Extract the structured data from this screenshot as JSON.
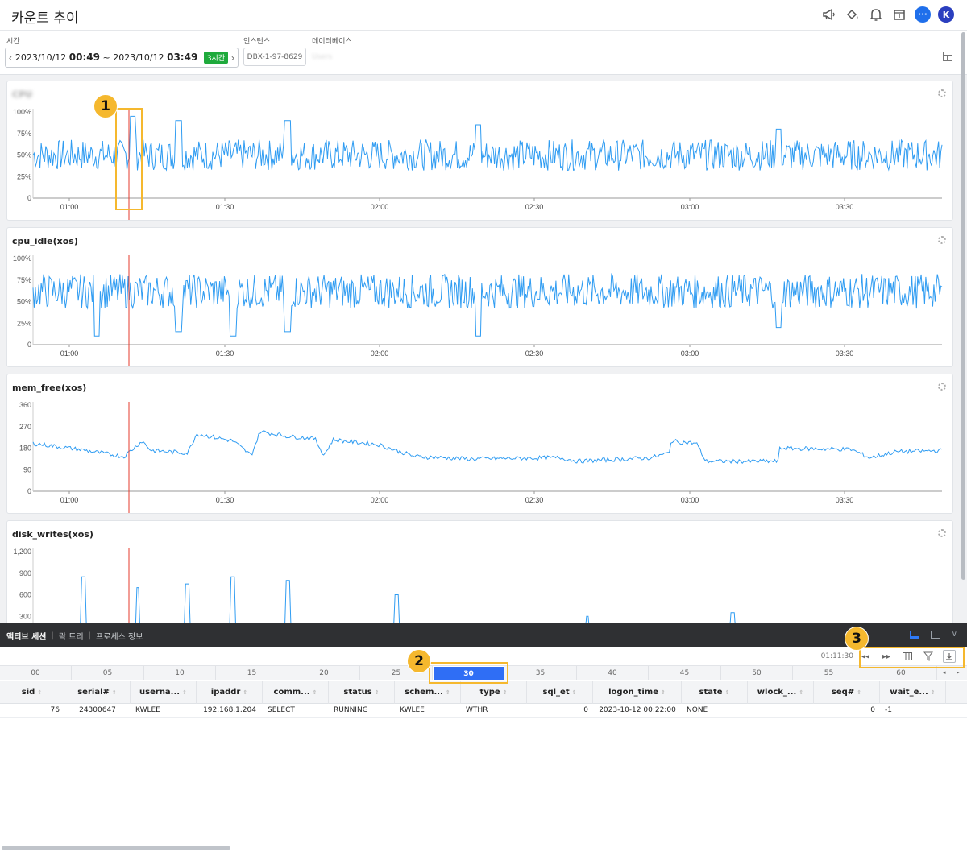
{
  "header": {
    "title": "카운트 추이",
    "icons": [
      "megaphone-icon",
      "paint-bucket-icon",
      "bell-icon",
      "calendar-icon",
      "chat-icon"
    ],
    "avatar_letter": "K",
    "chat_glyph": "···"
  },
  "filters": {
    "time_label": "시간",
    "time_start_date": "2023/10/12",
    "time_start_hm": "00:49",
    "time_sep": "~",
    "time_end_date": "2023/10/12",
    "time_end_hm": "03:49",
    "time_range_badge": "3시간",
    "prev_arrow": "‹",
    "next_arrow": "›",
    "instance_label": "인스턴스",
    "instance_value": "DBX-1-97-8629",
    "database_label": "데이터베이스",
    "database_value": "Users"
  },
  "charts": [
    {
      "title": "CPU",
      "title_blurred": true,
      "y_ticks": [
        "100%",
        "75%",
        "50%",
        "25%",
        "0"
      ],
      "x_ticks": [
        "01:00",
        "01:30",
        "02:00",
        "02:30",
        "03:00",
        "03:30"
      ],
      "chart_data": {
        "type": "line",
        "ylim": [
          0,
          100
        ],
        "x_range": [
          "00:49",
          "03:49"
        ],
        "cursor_time": "01:12",
        "baseline": 50,
        "amplitude": 18,
        "spikes": [
          [
            0.11,
            95
          ],
          [
            0.16,
            90
          ],
          [
            0.28,
            90
          ],
          [
            0.49,
            85
          ],
          [
            0.82,
            80
          ]
        ]
      }
    },
    {
      "title": "cpu_idle(xos)",
      "title_blurred": false,
      "y_ticks": [
        "100%",
        "75%",
        "50%",
        "25%",
        "0"
      ],
      "x_ticks": [
        "01:00",
        "01:30",
        "02:00",
        "02:30",
        "03:00",
        "03:30"
      ],
      "chart_data": {
        "type": "line",
        "ylim": [
          0,
          100
        ],
        "x_range": [
          "00:49",
          "03:49"
        ],
        "cursor_time": "01:12",
        "baseline": 62,
        "amplitude": 20,
        "dips": [
          [
            0.07,
            10
          ],
          [
            0.16,
            15
          ],
          [
            0.22,
            10
          ],
          [
            0.28,
            15
          ],
          [
            0.49,
            10
          ],
          [
            0.82,
            20
          ]
        ]
      }
    },
    {
      "title": "mem_free(xos)",
      "title_blurred": false,
      "y_ticks": [
        "360",
        "270",
        "180",
        "90",
        "0"
      ],
      "x_ticks": [
        "01:00",
        "01:30",
        "02:00",
        "02:30",
        "03:00",
        "03:30"
      ],
      "chart_data": {
        "type": "line",
        "ylim": [
          0,
          360
        ],
        "x_range": [
          "00:49",
          "03:49"
        ],
        "cursor_time": "01:12",
        "points": [
          [
            0.0,
            200
          ],
          [
            0.05,
            175
          ],
          [
            0.1,
            145
          ],
          [
            0.12,
            210
          ],
          [
            0.13,
            170
          ],
          [
            0.17,
            160
          ],
          [
            0.18,
            240
          ],
          [
            0.22,
            210
          ],
          [
            0.24,
            150
          ],
          [
            0.25,
            250
          ],
          [
            0.28,
            230
          ],
          [
            0.31,
            220
          ],
          [
            0.32,
            150
          ],
          [
            0.33,
            215
          ],
          [
            0.38,
            195
          ],
          [
            0.42,
            145
          ],
          [
            0.48,
            135
          ],
          [
            0.58,
            140
          ],
          [
            0.6,
            125
          ],
          [
            0.68,
            140
          ],
          [
            0.7,
            160
          ],
          [
            0.7,
            210
          ],
          [
            0.73,
            200
          ],
          [
            0.74,
            125
          ],
          [
            0.82,
            125
          ],
          [
            0.82,
            180
          ],
          [
            0.9,
            175
          ],
          [
            0.92,
            140
          ],
          [
            0.95,
            165
          ],
          [
            1.0,
            170
          ]
        ]
      }
    },
    {
      "title": "disk_writes(xos)",
      "title_blurred": false,
      "y_ticks": [
        "1,200",
        "900",
        "600",
        "300"
      ],
      "x_ticks": [],
      "chart_data": {
        "type": "line",
        "ylim": [
          0,
          1200
        ],
        "x_range": [
          "00:49",
          "03:49"
        ],
        "cursor_time": "01:12",
        "spikes": [
          [
            0.055,
            850
          ],
          [
            0.115,
            700
          ],
          [
            0.17,
            750
          ],
          [
            0.22,
            850
          ],
          [
            0.28,
            800
          ],
          [
            0.4,
            600
          ],
          [
            0.61,
            300
          ],
          [
            0.77,
            350
          ]
        ]
      }
    }
  ],
  "bottom_tabs": [
    "액티브 세션",
    "락 트리",
    "프로세스 정보"
  ],
  "session": {
    "time_display": "01:11:30",
    "toolbar_icons": [
      "rewind-icon",
      "fast-forward-icon",
      "columns-icon",
      "filter-icon",
      "download-icon"
    ],
    "timeline": [
      "00",
      "05",
      "10",
      "15",
      "20",
      "25",
      "30",
      "35",
      "40",
      "45",
      "50",
      "55",
      "60"
    ],
    "timeline_selected": "30",
    "columns": [
      "sid",
      "serial#",
      "userna...",
      "ipaddr",
      "comm...",
      "status",
      "schem...",
      "type",
      "sql_et",
      "logon_time",
      "state",
      "wlock_...",
      "seq#",
      "wait_e..."
    ],
    "rows": [
      [
        "76",
        "24300647",
        "KWLEE",
        "192.168.1.204",
        "SELECT",
        "RUNNING",
        "KWLEE",
        "WTHR",
        "0",
        "2023-10-12 00:22:00",
        "NONE",
        "",
        "0",
        "-1"
      ]
    ]
  },
  "annotations": [
    "1",
    "2",
    "3"
  ],
  "colors": {
    "line": "#2f9cf2",
    "cursor": "#e53b2c",
    "highlight": "#f5b82e",
    "timeline_active": "#2f6ef5",
    "badge_green": "#1faa3c"
  }
}
